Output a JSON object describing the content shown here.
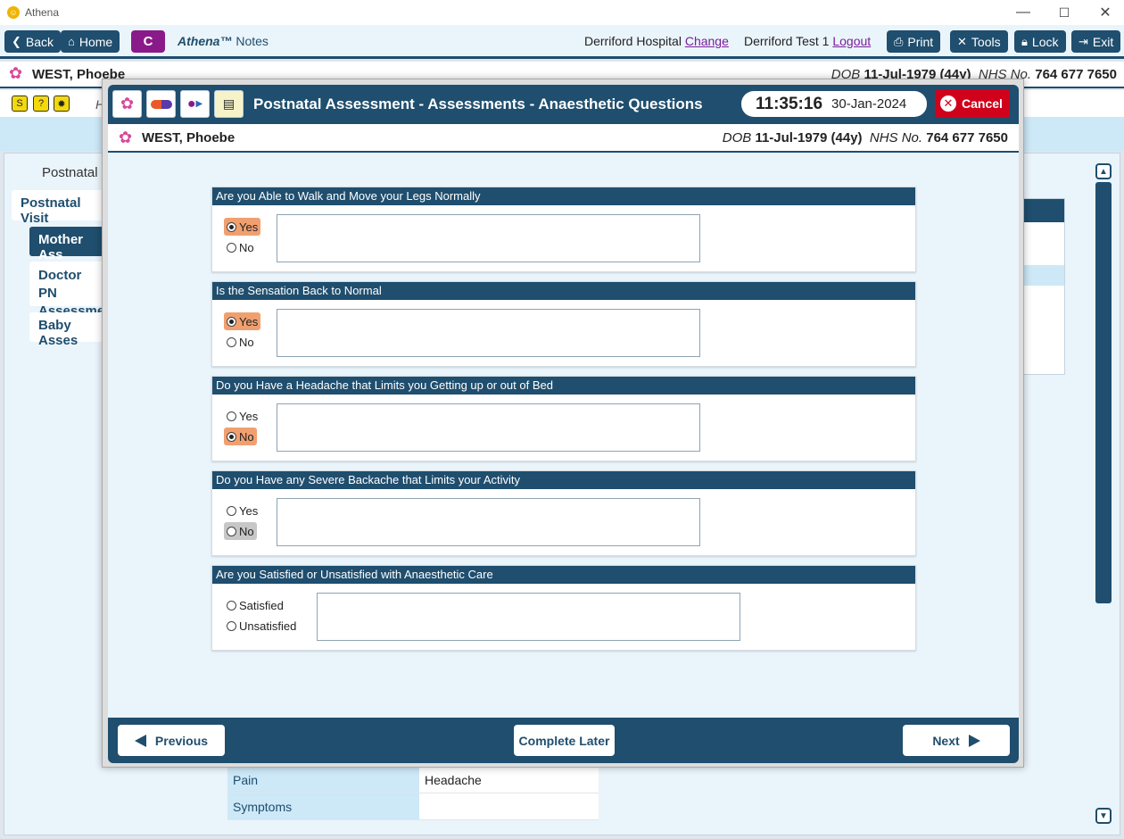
{
  "window": {
    "title": "Athena",
    "minimize": "—",
    "maximize": "☐",
    "close": "✕"
  },
  "toolbar": {
    "back": "Back",
    "home": "Home",
    "c_label": "C",
    "brand_name": "Athena™",
    "brand_suffix": "Notes",
    "hospital": "Derriford Hospital",
    "change": "Change",
    "user": "Derriford Test 1",
    "logout": "Logout",
    "print": "Print",
    "tools": "Tools",
    "lock": "Lock",
    "exit": "Exit"
  },
  "patient": {
    "name": "WEST, Phoebe",
    "dob_label": "DOB",
    "dob": "11-Jul-1979 (44y)",
    "nhs_label": "NHS No.",
    "nhs": "764 677 7650"
  },
  "background": {
    "subbar_text": "H",
    "crumb": "Postnatal",
    "nav": [
      "Postnatal Visit",
      "Mother Ass",
      "Doctor PN",
      "Assessmen",
      "Baby Asses"
    ],
    "table": [
      {
        "key": "Pain",
        "value": "Headache"
      },
      {
        "key": "Symptoms",
        "value": ""
      }
    ]
  },
  "modal": {
    "title": "Postnatal Assessment - Assessments - Anaesthetic Questions",
    "time": "11:35:16",
    "date": "30-Jan-2024",
    "cancel": "Cancel",
    "questions": [
      {
        "title": "Are you Able to Walk and Move your Legs Normally",
        "options": [
          "Yes",
          "No"
        ],
        "selected": "Yes"
      },
      {
        "title": "Is the Sensation Back to Normal",
        "options": [
          "Yes",
          "No"
        ],
        "selected": "Yes"
      },
      {
        "title": "Do you Have a Headache that Limits you Getting up or out of Bed",
        "options": [
          "Yes",
          "No"
        ],
        "selected": "No"
      },
      {
        "title": "Do you Have any Severe Backache that Limits your Activity",
        "options": [
          "Yes",
          "No"
        ],
        "selected": ""
      },
      {
        "title": "Are you Satisfied or Unsatisfied with Anaesthetic Care",
        "options": [
          "Satisfied",
          "Unsatisfied"
        ],
        "selected": ""
      }
    ],
    "previous": "Previous",
    "complete_later": "Complete Later",
    "next": "Next"
  },
  "colors": {
    "primary": "#1f4e6e",
    "selected_option": "#f0a070",
    "cancel": "#d0021b",
    "accent_purple": "#8a1a8a"
  }
}
